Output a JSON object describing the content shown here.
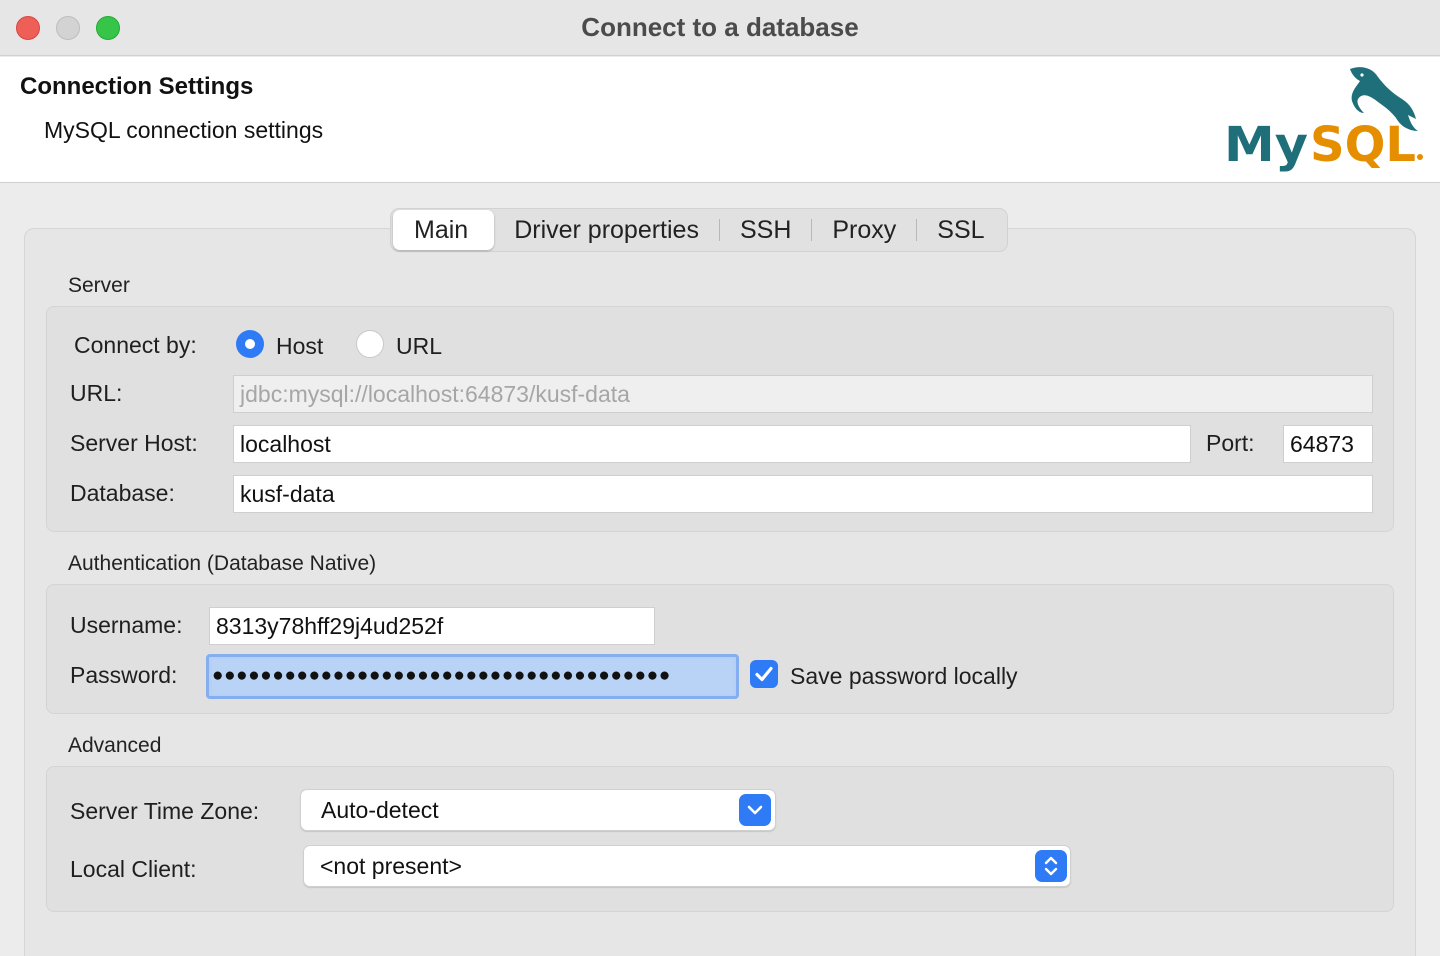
{
  "window": {
    "title": "Connect to a database"
  },
  "header": {
    "title": "Connection Settings",
    "subtitle": "MySQL connection settings",
    "logo_text": "MySQL"
  },
  "tabs": [
    {
      "label": "Main",
      "active": true
    },
    {
      "label": "Driver properties",
      "active": false
    },
    {
      "label": "SSH",
      "active": false
    },
    {
      "label": "Proxy",
      "active": false
    },
    {
      "label": "SSL",
      "active": false
    }
  ],
  "server": {
    "section_label": "Server",
    "connect_by_label": "Connect by:",
    "option_host": "Host",
    "option_url": "URL",
    "selected": "Host",
    "url_label": "URL:",
    "url_value": "jdbc:mysql://localhost:64873/kusf-data",
    "host_label": "Server Host:",
    "host_value": "localhost",
    "port_label": "Port:",
    "port_value": "64873",
    "database_label": "Database:",
    "database_value": "kusf-data"
  },
  "auth": {
    "section_label": "Authentication (Database Native)",
    "username_label": "Username:",
    "username_value": "8313y78hff29j4ud252f",
    "password_label": "Password:",
    "password_mask": "●●●●●●●●●●●●●●●●●●●●●●●●●●●●●●●●●●●●●●",
    "save_password_label": "Save password locally",
    "save_password_checked": true
  },
  "advanced": {
    "section_label": "Advanced",
    "timezone_label": "Server Time Zone:",
    "timezone_value": "Auto-detect",
    "local_client_label": "Local Client:",
    "local_client_value": "<not present>"
  },
  "colors": {
    "accent": "#2f7bf6",
    "mysql_teal": "#1f6f7a",
    "mysql_orange": "#e48e00"
  }
}
